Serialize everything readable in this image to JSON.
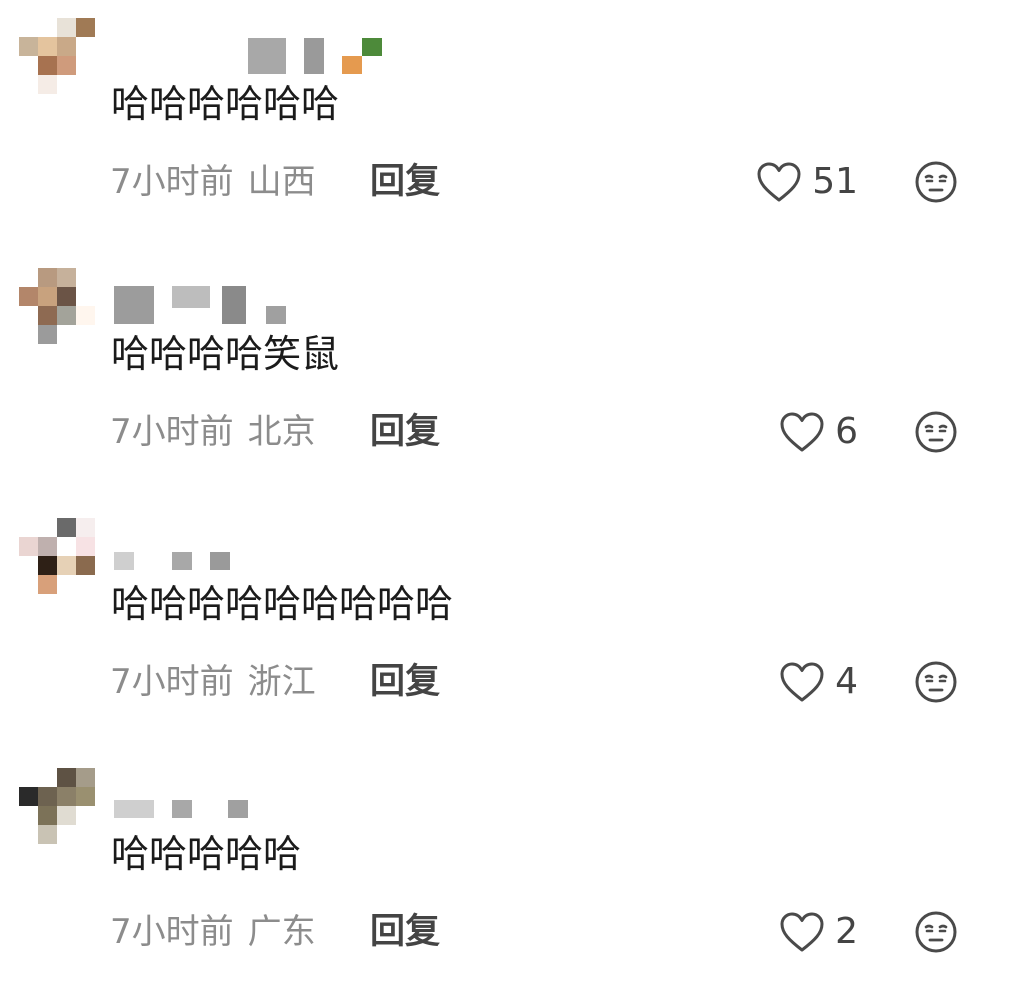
{
  "comments": [
    {
      "text": "哈哈哈哈哈哈",
      "time": "7小时前",
      "location": "山西",
      "reply_label": "回复",
      "likes": "51",
      "avatar_colors": [
        "#ffffff",
        "#e8e2d8",
        "#a07a55",
        "#c8b49a",
        "#e4c49e",
        "#c9a988",
        "#ffffff",
        "#a77250",
        "#cf9b7c",
        "#ffffff",
        "#f5ece6",
        "#ffffff"
      ],
      "name_blocks": [
        {
          "color": "#a8a8a8"
        },
        {
          "color": "#9a9a9a"
        },
        {
          "color": "#4d8a3a"
        },
        {
          "color": "#e59a4f"
        }
      ]
    },
    {
      "text": "哈哈哈哈笑鼠",
      "time": "7小时前",
      "location": "北京",
      "reply_label": "回复",
      "likes": "6",
      "avatar_colors": [
        "#b89a80",
        "#c6b19b",
        "#ffffff",
        "#b3866a",
        "#c8a27e",
        "#6b5446",
        "#ffffff",
        "#8e6a52",
        "#a3a39a",
        "#fff6ee",
        "#9b9b9b",
        "#ffffff"
      ],
      "name_blocks": [
        {
          "color": "#9c9c9c"
        },
        {
          "color": "#bdbdbd"
        },
        {
          "color": "#8a8a8a"
        },
        {
          "color": "#a0a0a0"
        }
      ]
    },
    {
      "text": "哈哈哈哈哈哈哈哈哈",
      "time": "7小时前",
      "location": "浙江",
      "reply_label": "回复",
      "likes": "4",
      "avatar_colors": [
        "#ffffff",
        "#6a6a6a",
        "#f6eeee",
        "#ead5d2",
        "#bfb0ae",
        "#ffffff",
        "#f7e2e4",
        "#2e2016",
        "#e6d1b6",
        "#8a6a4e",
        "#d8a07a",
        "#ffffff"
      ],
      "name_blocks": [
        {
          "color": "#cfcfcf"
        },
        {
          "color": "#a8a8a8"
        },
        {
          "color": "#9a9a9a"
        }
      ]
    },
    {
      "text": "哈哈哈哈哈",
      "time": "7小时前",
      "location": "广东",
      "reply_label": "回复",
      "likes": "2",
      "avatar_colors": [
        "#ffffff",
        "#5e5244",
        "#a59c8a",
        "#2a2a2a",
        "#6d6250",
        "#8b8068",
        "#9a9070",
        "#7c7258",
        "#e0dcd2",
        "#ffffff",
        "#c9c3b4",
        "#ffffff"
      ],
      "name_blocks": [
        {
          "color": "#cfcfcf"
        },
        {
          "color": "#a8a8a8"
        },
        {
          "color": "#a0a0a0"
        }
      ]
    }
  ],
  "icons": {
    "like": "heart-outline-icon",
    "emoji": "face-emoji-icon"
  }
}
